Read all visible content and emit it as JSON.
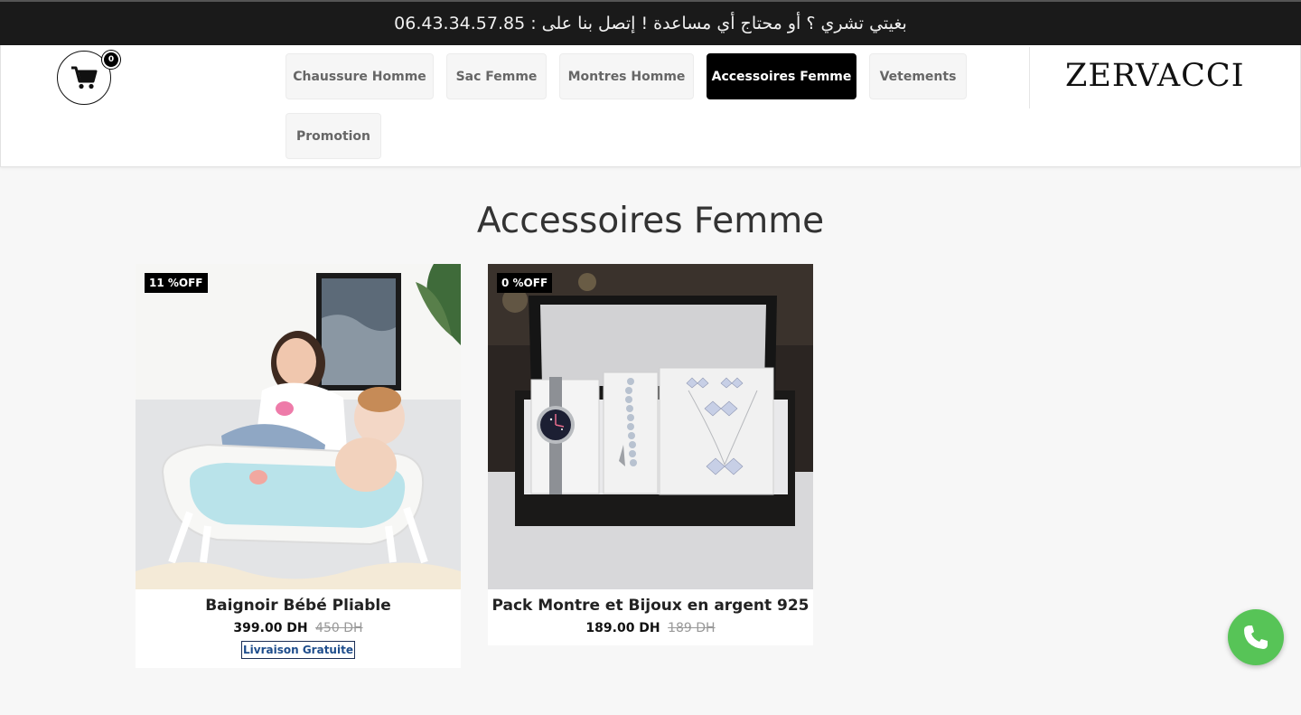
{
  "topbar": {
    "text": "بغيتي تشري ؟ أو محتاج أي مساعدة ! إتصل بنا على : 06.43.34.57.85"
  },
  "header": {
    "cart_icon": "shopping-cart-icon",
    "cart_count": "0",
    "nav": [
      {
        "label": "Chaussure Homme",
        "active": false
      },
      {
        "label": "Sac Femme",
        "active": false
      },
      {
        "label": "Montres Homme",
        "active": false
      },
      {
        "label": "Accessoires Femme",
        "active": true
      },
      {
        "label": "Vetements",
        "active": false
      },
      {
        "label": "Promotion",
        "active": false
      }
    ],
    "logo": "ZERVACCI"
  },
  "page": {
    "title": "Accessoires Femme"
  },
  "products": [
    {
      "badge": "11 %OFF",
      "name": "Baignoir Bébé Pliable",
      "price": "399.00 DH",
      "old_price": "450 DH",
      "shipping": "Livraison Gratuite"
    },
    {
      "badge": "0 %OFF",
      "name": "Pack Montre et Bijoux en argent 925",
      "price": "189.00 DH",
      "old_price": "189 DH"
    }
  ],
  "floating": {
    "call_icon": "phone-icon"
  },
  "colors": {
    "topbar_bg": "#1a1a1a",
    "active_nav_bg": "#000000",
    "call_button": "#57c457",
    "shipping_text": "#1e4d8c"
  }
}
